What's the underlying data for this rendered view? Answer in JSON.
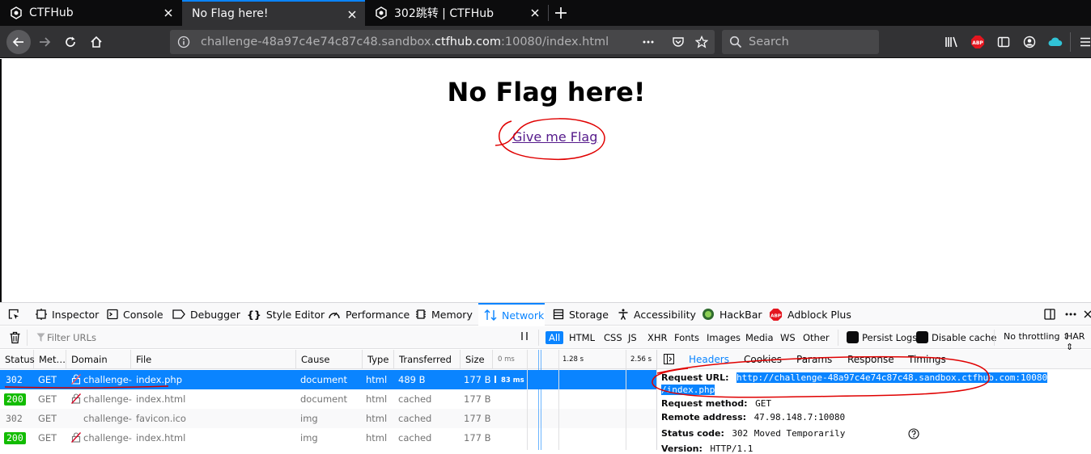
{
  "tabs": [
    {
      "title": "CTFHub",
      "active": false
    },
    {
      "title": "No Flag here!",
      "active": true
    },
    {
      "title": "302跳转 | CTFHub",
      "active": false
    }
  ],
  "navbar": {
    "url_prefix": "challenge-48a97c4e74c87c48.sandbox.",
    "url_host": "ctfhub.com",
    "url_suffix": ":10080/index.html",
    "search_placeholder": "Search"
  },
  "page": {
    "heading": "No Flag here!",
    "link_text": "Give me Flag"
  },
  "devtools": {
    "tabs": [
      "Inspector",
      "Console",
      "Debugger",
      "Style Editor",
      "Performance",
      "Memory",
      "Network",
      "Storage",
      "Accessibility",
      "HackBar",
      "Adblock Plus"
    ],
    "selected_tab": "Network",
    "filter_placeholder": "Filter URLs",
    "filter_types": [
      "All",
      "HTML",
      "CSS",
      "JS",
      "XHR",
      "Fonts",
      "Images",
      "Media",
      "WS",
      "Other"
    ],
    "persist_logs": "Persist Logs",
    "disable_cache": "Disable cache",
    "throttling": "No throttling ⇕",
    "har": "HAR ⇕",
    "columns": [
      "Status",
      "Met…",
      "Domain",
      "File",
      "Cause",
      "Type",
      "Transferred",
      "Size"
    ],
    "timeline_ticks": [
      "0 ms",
      "1.28 s",
      "2.56 s"
    ],
    "requests": [
      {
        "status": "302",
        "method": "GET",
        "domain": "challenge-…",
        "file": "index.php",
        "cause": "document",
        "type": "html",
        "transferred": "489 B",
        "size": "177 B",
        "timing": "83 ms",
        "selected": true
      },
      {
        "status": "200",
        "method": "GET",
        "domain": "challenge-…",
        "file": "index.html",
        "cause": "document",
        "type": "html",
        "transferred": "cached",
        "size": "177 B"
      },
      {
        "status": "302",
        "method": "GET",
        "domain": "challenge-…",
        "file": "favicon.ico",
        "cause": "img",
        "type": "html",
        "transferred": "cached",
        "size": "177 B"
      },
      {
        "status": "200",
        "method": "GET",
        "domain": "challenge-…",
        "file": "index.html",
        "cause": "img",
        "type": "html",
        "transferred": "cached",
        "size": "177 B"
      }
    ],
    "side_tabs": [
      "Headers",
      "Cookies",
      "Params",
      "Response",
      "Timings"
    ],
    "side_selected": "Headers",
    "details": {
      "request_url_label": "Request URL:",
      "request_url_line1": "http://challenge-48a97c4e74c87c48.sandbox.ctfhub.com:10080",
      "request_url_line2": "/index.php",
      "request_method_label": "Request method:",
      "request_method": "GET",
      "remote_address_label": "Remote address:",
      "remote_address": "47.98.148.7:10080",
      "status_code_label": "Status code:",
      "status_code": "302",
      "status_text": "Moved Temporarily",
      "version_label": "Version:",
      "version": "HTTP/1.1"
    }
  },
  "colors": {
    "accent": "#0a84ff",
    "status_ok": "#12bc00",
    "annotation": "#e00000"
  }
}
